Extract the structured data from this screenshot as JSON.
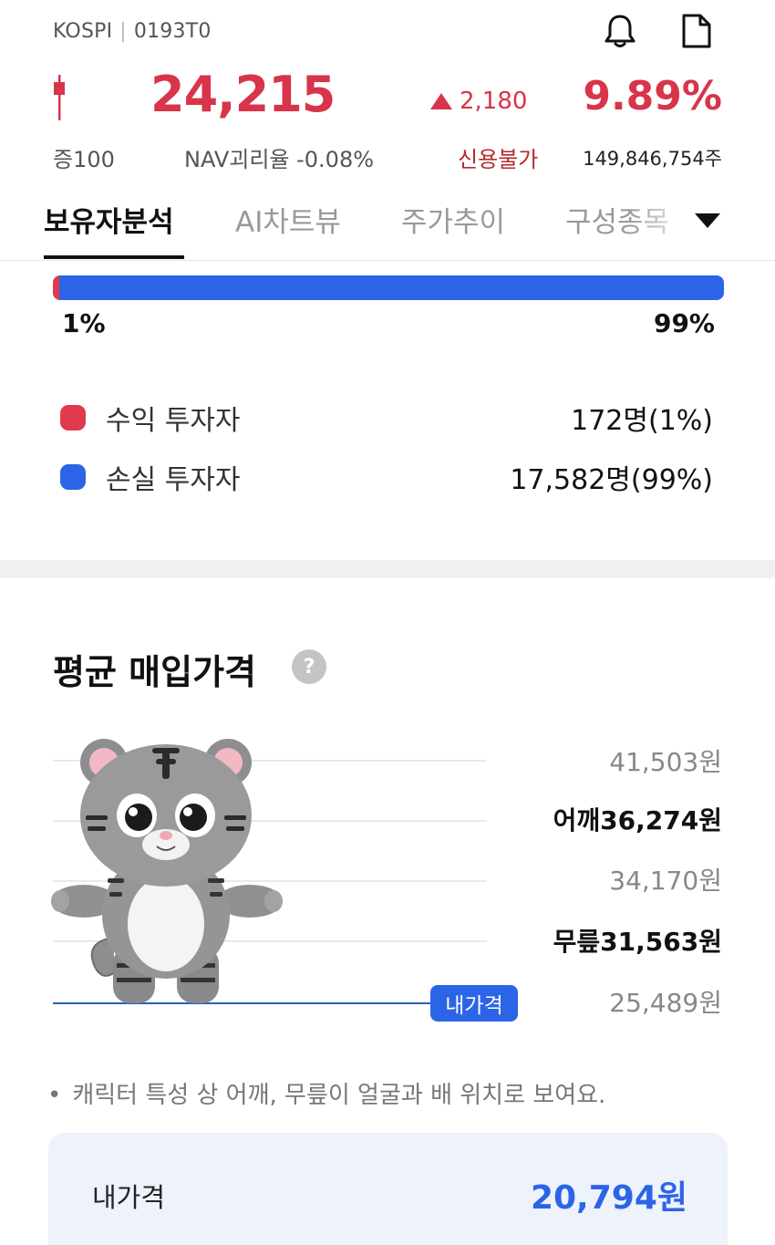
{
  "header": {
    "market": "KOSPI",
    "code": "0193T0",
    "icons": {
      "bell": "bell-icon",
      "document": "document-icon",
      "candle": "candle-icon"
    }
  },
  "quote": {
    "price": "24,215",
    "change": "2,180",
    "change_pct": "9.89%",
    "margin": "증100",
    "nav_gap": "NAV괴리율 -0.08%",
    "credit": "신용불가",
    "shares": "149,846,754주"
  },
  "tabs": [
    "보유자분석",
    "AI차트뷰",
    "주가추이",
    "구성종목"
  ],
  "ratio": {
    "gain_pct_label": "1%",
    "loss_pct_label": "99%",
    "gain_fraction": 0.01,
    "legend": [
      {
        "label": "수익 투자자",
        "value": "172명(1%)",
        "color": "#e23a4d"
      },
      {
        "label": "손실 투자자",
        "value": "17,582명(99%)",
        "color": "#2c64e8"
      }
    ]
  },
  "avg_price": {
    "title": "평균 매입가격",
    "help": "?",
    "levels": [
      {
        "text": "41,503원",
        "emphasis": false
      },
      {
        "text": "어깨36,274원",
        "emphasis": true
      },
      {
        "text": "34,170원",
        "emphasis": false
      },
      {
        "text": "무릎31,563원",
        "emphasis": true
      },
      {
        "text": "25,489원",
        "emphasis": false
      }
    ],
    "my_price_badge": "내가격",
    "note": "캐릭터 특성 상 어깨, 무릎이 얼굴과 배 위치로 보여요.",
    "note_bullet": "•"
  },
  "my_price": {
    "label": "내가격",
    "value": "20,794원"
  },
  "colors": {
    "up": "#d8344a",
    "gain": "#e23a4d",
    "loss": "#2c64e8"
  }
}
